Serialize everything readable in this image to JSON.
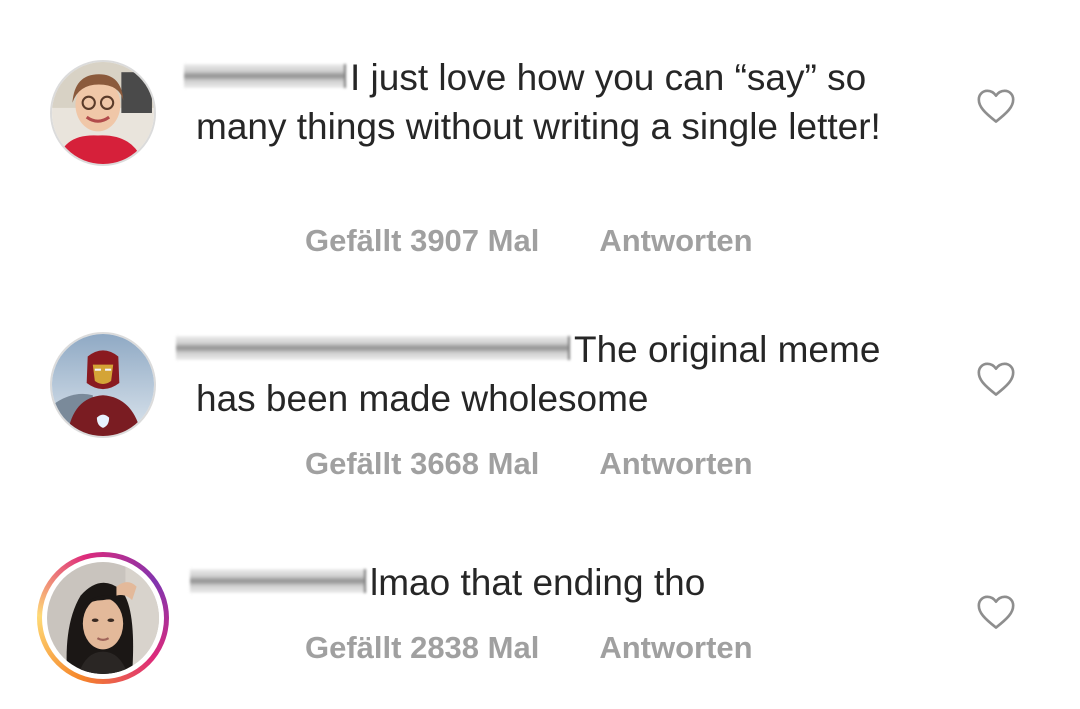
{
  "comments": [
    {
      "text": "I just love how you can “say” so many things without writing a single letter!",
      "likes_label": "Gefällt 3907 Mal",
      "reply_label": "Antworten",
      "avatar_icon": "user-avatar-icon",
      "like_icon": "heart-outline-icon",
      "has_story_ring": false
    },
    {
      "text": "The original meme has been made wholesome",
      "likes_label": "Gefällt 3668 Mal",
      "reply_label": "Antworten",
      "avatar_icon": "user-avatar-icon",
      "like_icon": "heart-outline-icon",
      "has_story_ring": false
    },
    {
      "text": "lmao that ending tho",
      "likes_label": "Gefällt 2838 Mal",
      "reply_label": "Antworten",
      "avatar_icon": "user-avatar-icon",
      "like_icon": "heart-outline-icon",
      "has_story_ring": true
    }
  ],
  "colors": {
    "text": "#262626",
    "meta": "#a0a0a0",
    "heart": "#8e8e8e",
    "story_ring_start": "#f58529",
    "story_ring_end": "#dd2a7b"
  }
}
